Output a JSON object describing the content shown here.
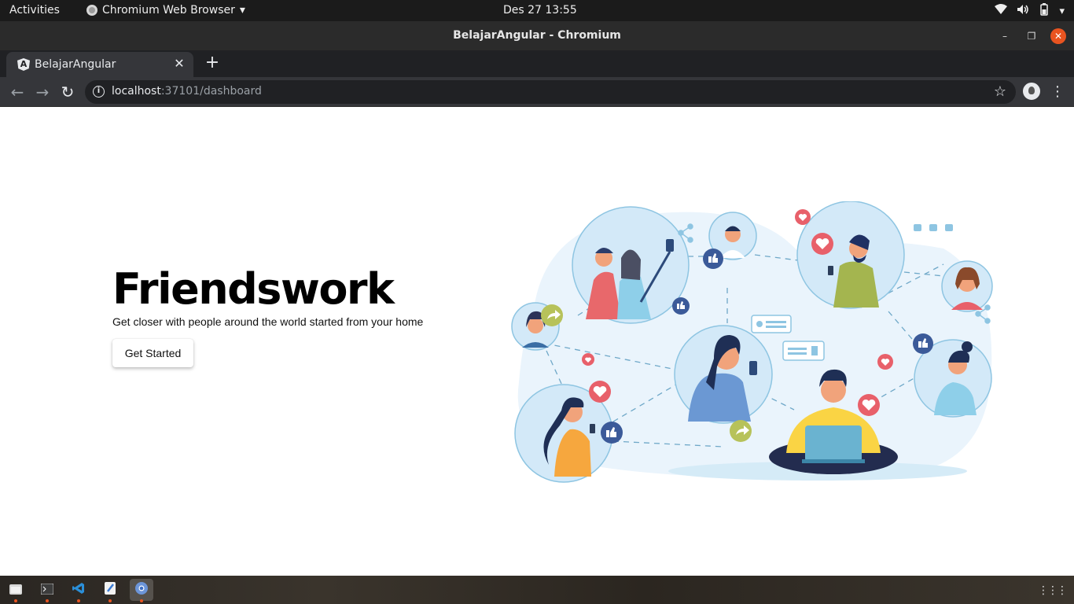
{
  "system": {
    "activities": "Activities",
    "app_menu": "Chromium Web Browser",
    "clock": "Des 27  13:55"
  },
  "window": {
    "title": "BelajarAngular - Chromium"
  },
  "tab": {
    "title": "BelajarAngular",
    "favicon_letter": "A"
  },
  "omnibox": {
    "host": "localhost",
    "rest": ":37101/dashboard"
  },
  "hero": {
    "title": "Friendswork",
    "subtitle": "Get closer with people around the world started from your home",
    "button": "Get Started"
  },
  "colors": {
    "accent_red": "#e8606a",
    "thumb_blue": "#3b5a99",
    "share_olive": "#b7c25a",
    "bubble_blue": "#d7eaf9",
    "ubuntu_orange": "#e95420"
  },
  "dock": {
    "apps": [
      "files-icon",
      "terminal-icon",
      "vscode-icon",
      "text-editor-icon",
      "chromium-icon"
    ]
  }
}
